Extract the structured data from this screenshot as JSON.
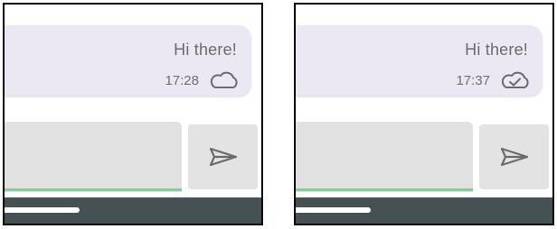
{
  "screens": [
    {
      "message": {
        "text": "Hi there!",
        "time": "17:28",
        "status_icon": "cloud-icon"
      },
      "composer": {
        "input_value": "",
        "send_icon": "send-icon"
      }
    },
    {
      "message": {
        "text": "Hi there!",
        "time": "17:37",
        "status_icon": "cloud-check-icon"
      },
      "composer": {
        "input_value": "",
        "send_icon": "send-icon"
      }
    }
  ],
  "colors": {
    "bubble": "#ebe8f3",
    "input_underline": "#6fd98e",
    "nav_bar": "#465154",
    "text": "#6b6b6b"
  }
}
